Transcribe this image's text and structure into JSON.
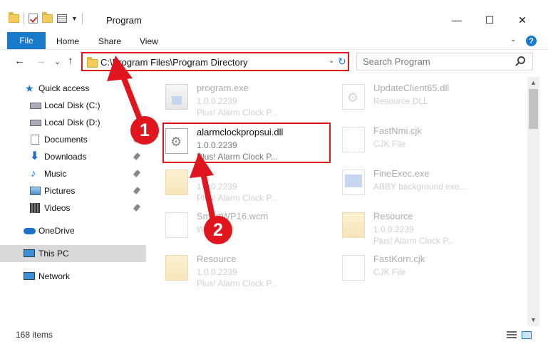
{
  "window": {
    "title": "Program",
    "minimize": "—",
    "maximize": "☐",
    "close": "✕"
  },
  "ribbon": {
    "tabs": [
      "File",
      "Home",
      "Share",
      "View"
    ],
    "expand": "⌄",
    "help": "?"
  },
  "nav": {
    "back": "←",
    "forward": "→",
    "recent": "⌄",
    "up": "↑"
  },
  "address": {
    "path": "C:\\Program Files\\Program Directory",
    "dropdown": "⌄",
    "refresh": "↻"
  },
  "search": {
    "placeholder": "Search Program"
  },
  "navpane": {
    "items": [
      {
        "label": "Quick access",
        "icon": "star-icon"
      },
      {
        "label": "Local Disk (C:)",
        "icon": "disk-icon"
      },
      {
        "label": "Local Disk (D:)",
        "icon": "disk-icon"
      },
      {
        "label": "Documents",
        "icon": "documents-icon"
      },
      {
        "label": "Downloads",
        "icon": "downloads-icon"
      },
      {
        "label": "Music",
        "icon": "music-icon"
      },
      {
        "label": "Pictures",
        "icon": "pictures-icon"
      },
      {
        "label": "Videos",
        "icon": "videos-icon"
      },
      {
        "label": "OneDrive",
        "icon": "onedrive-icon"
      },
      {
        "label": "This PC",
        "icon": "pc-icon"
      },
      {
        "label": "Network",
        "icon": "network-icon"
      }
    ]
  },
  "files": [
    {
      "name": "program.exe",
      "meta1": "1.0.0.2239",
      "meta2": "Plus! Alarm Clock P..."
    },
    {
      "name": "UpdateClient65.dll",
      "meta1": "Resource DLL",
      "meta2": ""
    },
    {
      "name": "alarmclockpropsui.dll",
      "meta1": "1.0.0.2239",
      "meta2": "Plus! Alarm Clock P..."
    },
    {
      "name": "FastNmi.cjk",
      "meta1": "CJK File",
      "meta2": ""
    },
    {
      "name": "",
      "meta1": "1.0.0.2239",
      "meta2": "Plus! Alarm Clock P..."
    },
    {
      "name": "FineExec.exe",
      "meta1": "ABBY background exe...",
      "meta2": ""
    },
    {
      "name": "SmartWP16.wcm",
      "meta1": "WCM File",
      "meta2": ""
    },
    {
      "name": "Resource",
      "meta1": "1.0.0.2239",
      "meta2": "Plus! Alarm Clock P..."
    },
    {
      "name": "Resource",
      "meta1": "1.0.0.2239",
      "meta2": "Plus! Alarm Clock P..."
    },
    {
      "name": "FastKorn.cjk",
      "meta1": "CJK File",
      "meta2": ""
    }
  ],
  "status": {
    "items": "168 items"
  },
  "annotations": {
    "badge1": "1",
    "badge2": "2",
    "color": "#e0151e"
  },
  "colors": {
    "accent": "#1979ca",
    "highlight": "#e0151e"
  }
}
